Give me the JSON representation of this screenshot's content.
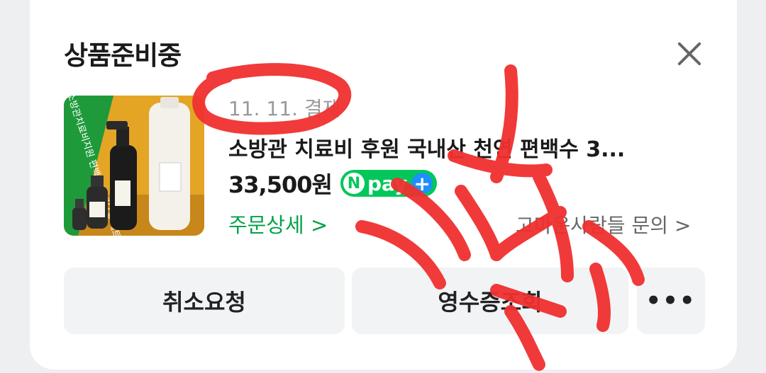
{
  "card": {
    "status_title": "상품준비중",
    "order_date": "11. 11. 결제",
    "product_name": "소방관 치료비 후원 국내산 천연 편백수 3...",
    "price": "33,500원",
    "npay_badge": {
      "n": "N",
      "label": "pay",
      "plus": "+"
    },
    "order_detail_link": "주문상세 >",
    "seller_inquiry_link": "고마운사람들 문의 >",
    "thumbnail_banner": "소방관치료비지원 편백수,편백오일 세트"
  },
  "actions": {
    "cancel_label": "취소요청",
    "receipt_label": "영수증조회",
    "more_label": "•••"
  },
  "colors": {
    "accent_green": "#03c75a",
    "link_green": "#03a14a",
    "scribble_red": "#f0302f"
  }
}
